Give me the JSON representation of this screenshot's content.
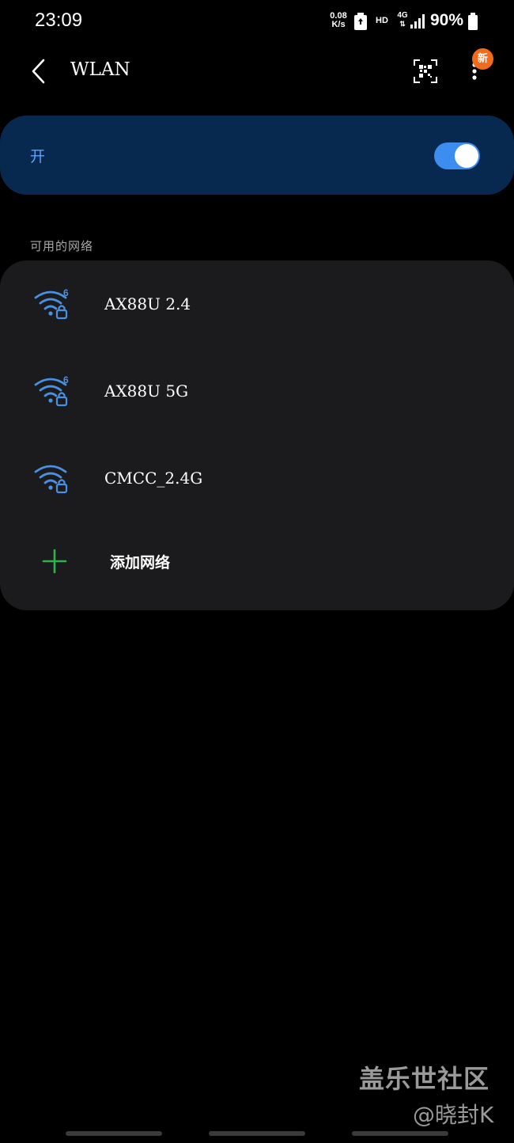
{
  "status_bar": {
    "time": "23:09",
    "net_speed_value": "0.08",
    "net_speed_unit": "K/s",
    "hd_label": "HD",
    "network_type": "4G",
    "battery_percent": "90%"
  },
  "header": {
    "title": "WLAN",
    "new_badge": "新"
  },
  "wlan_toggle": {
    "label": "开",
    "state": "on"
  },
  "section_header": "可用的网络",
  "networks": [
    {
      "name": "AX88U 2.4",
      "icon": "wifi-6-locked-icon"
    },
    {
      "name": "AX88U 5G",
      "icon": "wifi-6-locked-icon"
    },
    {
      "name": "CMCC_2.4G",
      "icon": "wifi-locked-icon"
    }
  ],
  "add_network_label": "添加网络",
  "watermark": {
    "line1": "盖乐世社区",
    "line2": "@晓封K"
  },
  "colors": {
    "accent": "#3d8cf0",
    "toggle_card_bg": "#07294f",
    "list_card_bg": "#1b1b1d",
    "wifi_icon": "#4a90e2",
    "add_icon": "#2db34a",
    "badge": "#f26b1d"
  }
}
